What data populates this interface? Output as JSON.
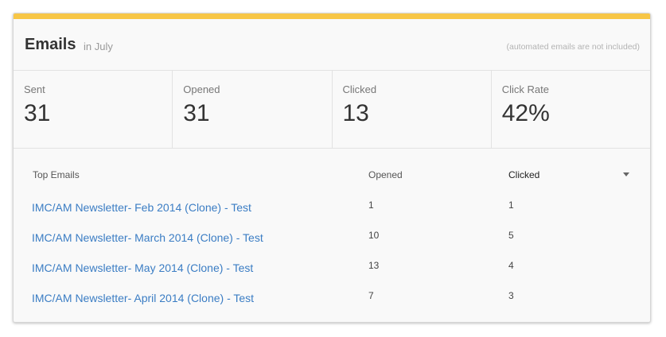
{
  "header": {
    "title": "Emails",
    "subtitle": "in July",
    "note": "(automated emails are not included)"
  },
  "stats": [
    {
      "label": "Sent",
      "value": "31"
    },
    {
      "label": "Opened",
      "value": "31"
    },
    {
      "label": "Clicked",
      "value": "13"
    },
    {
      "label": "Click Rate",
      "value": "42%"
    }
  ],
  "table": {
    "headers": {
      "name": "Top Emails",
      "opened": "Opened",
      "clicked": "Clicked"
    },
    "sort_icon": "chevron-down-icon",
    "rows": [
      {
        "name": "IMC/AM Newsletter- Feb 2014 (Clone) - Test",
        "opened": "1",
        "clicked": "1"
      },
      {
        "name": "IMC/AM Newsletter- March 2014 (Clone) - Test",
        "opened": "10",
        "clicked": "5"
      },
      {
        "name": "IMC/AM Newsletter- May 2014 (Clone) - Test",
        "opened": "13",
        "clicked": "4"
      },
      {
        "name": "IMC/AM Newsletter- April 2014 (Clone) - Test",
        "opened": "7",
        "clicked": "3"
      }
    ]
  },
  "colors": {
    "accent_bar": "#f7c646",
    "link": "#3b7dc4"
  }
}
